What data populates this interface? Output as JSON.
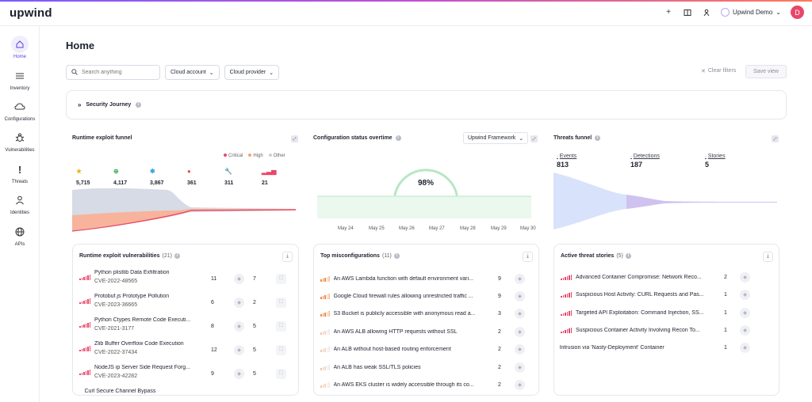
{
  "app": {
    "logo": "upwind"
  },
  "topbar": {
    "user_name": "Upwind Demo",
    "avatar_initial": "D"
  },
  "nav": [
    {
      "label": "Home"
    },
    {
      "label": "Inventory"
    },
    {
      "label": "Configurations"
    },
    {
      "label": "Vulnerabilities"
    },
    {
      "label": "Threats"
    },
    {
      "label": "Identities"
    },
    {
      "label": "APIs"
    }
  ],
  "page": {
    "title": "Home"
  },
  "filters": {
    "search_placeholder": "Search anything",
    "cloud_account": "Cloud account",
    "cloud_provider": "Cloud provider",
    "clear": "Clear filters",
    "save": "Save view"
  },
  "journey": {
    "title": "Security Journey"
  },
  "runtime_funnel": {
    "title": "Runtime exploit funnel",
    "legend": [
      "Critical",
      "High",
      "Other"
    ],
    "steps": [
      "5,715",
      "4,117",
      "3,867",
      "361",
      "311",
      "21"
    ]
  },
  "config_status": {
    "title": "Configuration status overtime",
    "framework": "Upwind Framework",
    "percent": "98%",
    "dates": [
      "May 24",
      "May 25",
      "May 26",
      "May 27",
      "May 28",
      "May 29",
      "May 30"
    ]
  },
  "threats_funnel": {
    "title": "Threats funnel",
    "stages": [
      {
        "label": "Events",
        "value": "813"
      },
      {
        "label": "Detections",
        "value": "187"
      },
      {
        "label": "Stories",
        "value": "5"
      }
    ]
  },
  "runtime_vulns": {
    "title": "Runtime exploit vulnerabilities",
    "count": "(21)",
    "rows": [
      {
        "name": "Python plistlib Data Exfiltration",
        "cve": "CVE-2022-48565",
        "a": "11",
        "b": "7"
      },
      {
        "name": "Protobuf.js Prototype Pollution",
        "cve": "CVE-2023-36665",
        "a": "6",
        "b": "2"
      },
      {
        "name": "Python Ctypes Remote Code Executi...",
        "cve": "CVE-2021-3177",
        "a": "8",
        "b": "5"
      },
      {
        "name": "Zlib Buffer Overflow Code Execution",
        "cve": "CVE-2022-37434",
        "a": "12",
        "b": "5"
      },
      {
        "name": "NodeJS ip Server Side Request Forg...",
        "cve": "CVE-2023-42282",
        "a": "9",
        "b": "5"
      },
      {
        "name": "Curl Secure Channel Bypass",
        "cve": "",
        "a": "",
        "b": ""
      }
    ]
  },
  "top_misconfigs": {
    "title": "Top misconfigurations",
    "count": "(11)",
    "rows": [
      {
        "name": "An AWS Lambda function with default environment vari...",
        "value": "9"
      },
      {
        "name": "Google Cloud firewall rules allowing unrestricted traffic ...",
        "value": "9"
      },
      {
        "name": "S3 Bucket is publicly accessible with anonymous read a...",
        "value": "3"
      },
      {
        "name": "An AWS ALB allowing HTTP requests without SSL",
        "value": "2"
      },
      {
        "name": "An ALB without host-based routing enforcement",
        "value": "2"
      },
      {
        "name": "An ALB has weak SSL/TLS policies",
        "value": "2"
      },
      {
        "name": "An AWS EKS cluster is widely accessible through its co...",
        "value": "2"
      }
    ]
  },
  "active_threats": {
    "title": "Active threat stories",
    "count": "(5)",
    "rows": [
      {
        "name": "Advanced Container Compromise: Network Reco...",
        "value": "2"
      },
      {
        "name": "Suspicious Host Activity: CURL Requests and Pas...",
        "value": "1"
      },
      {
        "name": "Targeted API Exploitation: Command Injection, SS...",
        "value": "1"
      },
      {
        "name": "Suspicious Container Activity Involving Recon To...",
        "value": "1"
      },
      {
        "name": "Intrusion via 'Nasty-Deployment' Container",
        "value": "1"
      }
    ]
  },
  "colors": {
    "accent": "#5a3ee6",
    "critical": "#e8476a",
    "high": "#f4a27a",
    "other": "#c9cfdd"
  }
}
